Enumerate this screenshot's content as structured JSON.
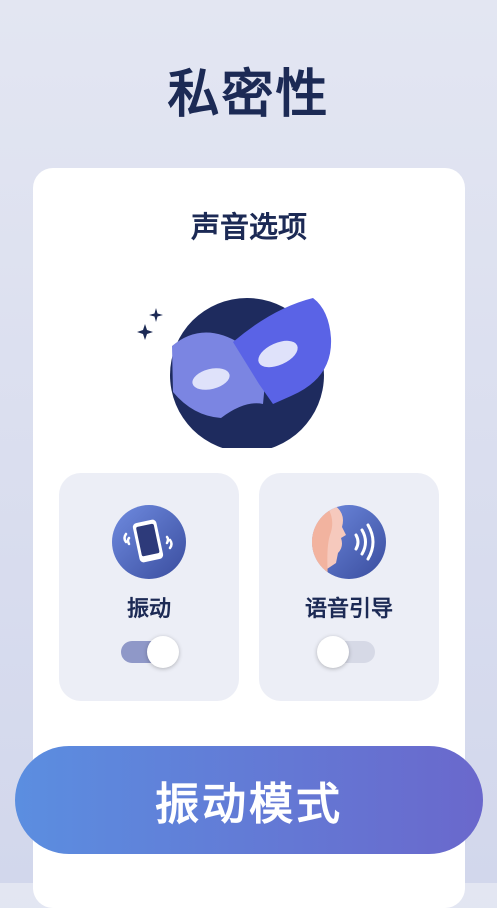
{
  "page": {
    "title": "私密性"
  },
  "card": {
    "title": "声音选项",
    "hero_icon": "mask-icon",
    "options": [
      {
        "label": "振动",
        "icon": "phone-vibrate-icon",
        "enabled": true
      },
      {
        "label": "语音引导",
        "icon": "voice-guide-icon",
        "enabled": false
      }
    ]
  },
  "action": {
    "label": "振动模式"
  },
  "colors": {
    "title": "#1c2a55",
    "accent_start": "#5b8ee0",
    "accent_end": "#6a68cc",
    "toggle_on": "#8f98c8",
    "toggle_off": "#d6d9e6"
  }
}
